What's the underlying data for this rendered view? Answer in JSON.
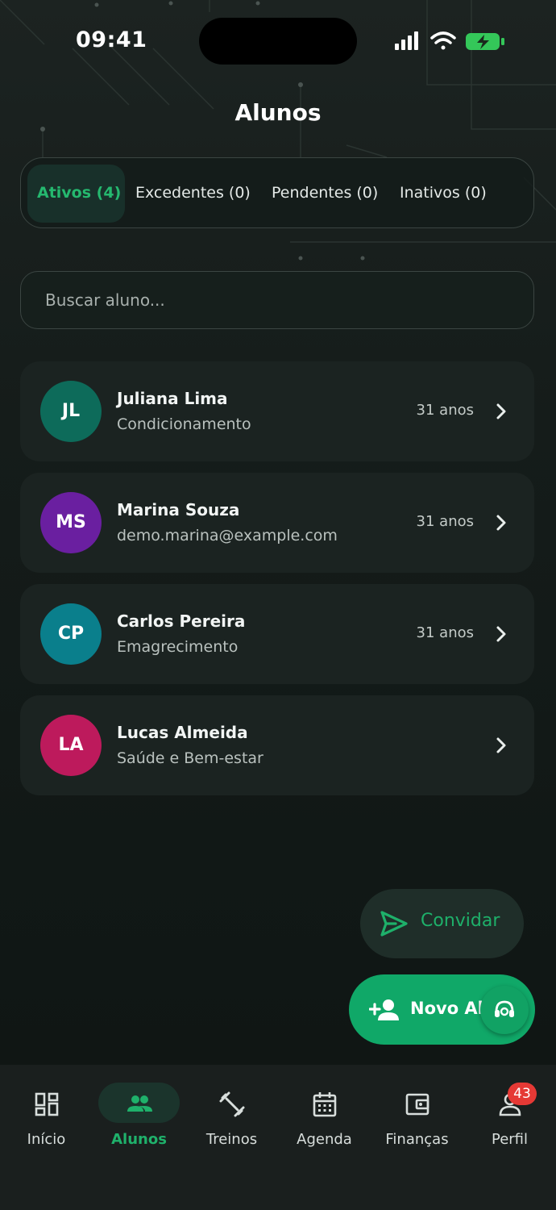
{
  "status_bar": {
    "time": "09:41",
    "icons": [
      "signal-icon",
      "wifi-icon",
      "battery-charging-icon"
    ]
  },
  "header": {
    "title": "Alunos"
  },
  "tabs": [
    {
      "label": "Ativos (4)",
      "active": true
    },
    {
      "label": "Excedentes (0)",
      "active": false
    },
    {
      "label": "Pendentes (0)",
      "active": false
    },
    {
      "label": "Inativos (0)",
      "active": false
    }
  ],
  "search": {
    "placeholder": "Buscar aluno...",
    "value": ""
  },
  "students": [
    {
      "initials": "JL",
      "name": "Juliana Lima",
      "subtitle": "Condicionamento",
      "age": "31 anos",
      "avatar_color": "#0d6b5a"
    },
    {
      "initials": "MS",
      "name": "Marina Souza",
      "subtitle": "demo.marina@example.com",
      "age": "31 anos",
      "avatar_color": "#6a1fa0"
    },
    {
      "initials": "CP",
      "name": "Carlos Pereira",
      "subtitle": "Emagrecimento",
      "age": "31 anos",
      "avatar_color": "#0a7f8c"
    },
    {
      "initials": "LA",
      "name": "Lucas Almeida",
      "subtitle": "Saúde e Bem-estar",
      "age": "",
      "avatar_color": "#bd1a5c"
    }
  ],
  "actions": {
    "invite_label": "Convidar",
    "new_student_label": "Novo Aluno"
  },
  "bottom_nav": [
    {
      "label": "Início",
      "icon": "dashboard-icon",
      "active": false
    },
    {
      "label": "Alunos",
      "icon": "people-icon",
      "active": true
    },
    {
      "label": "Treinos",
      "icon": "dumbbell-icon",
      "active": false
    },
    {
      "label": "Agenda",
      "icon": "calendar-icon",
      "active": false
    },
    {
      "label": "Finanças",
      "icon": "wallet-icon",
      "active": false
    },
    {
      "label": "Perfil",
      "icon": "person-icon",
      "active": false,
      "badge": "43"
    }
  ],
  "colors": {
    "accent": "#1fb16b",
    "background": "#111816",
    "card": "#1b2321",
    "badge": "#e53935"
  }
}
